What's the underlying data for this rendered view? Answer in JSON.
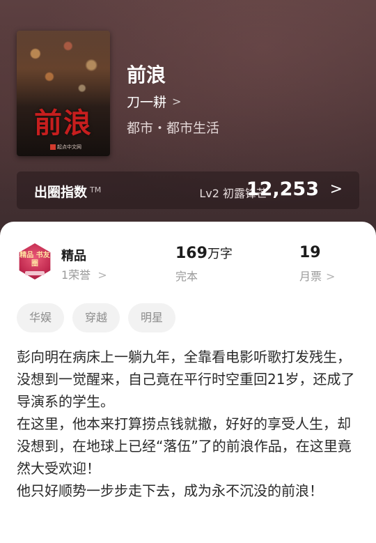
{
  "book": {
    "title": "前浪",
    "author": "刀一耕",
    "genre": "都市・都市生活",
    "cover_title": "前浪",
    "cover_publisher": "起点中文网"
  },
  "index": {
    "label": "出圈指数",
    "tm": "TM",
    "level": "Lv2 初露锋芒",
    "score": "12,253"
  },
  "stats": {
    "badge_text": "精品 书友圈",
    "honor_title": "精品",
    "honor_sub": "1荣誉",
    "words_value": "169",
    "words_unit": "万字",
    "words_status": "完本",
    "tickets_value": "19",
    "tickets_label": "月票"
  },
  "tags": [
    "华娱",
    "穿越",
    "明星"
  ],
  "description": [
    "彭向明在病床上一躺九年，全靠看电影听歌打发残生，没想到一觉醒来，自己竟在平行时空重回21岁，还成了导演系的学生。",
    "在这里，他本来打算捞点钱就撤，好好的享受人生，却没想到，在地球上已经“落伍”了的前浪作品，在这里竟然大受欢迎！",
    "他只好顺势一步步走下去，成为永不沉没的前浪！"
  ],
  "colors": {
    "hero_bg": "#4b3436",
    "badge": "#c1294f",
    "cover_title": "#c61e1e"
  },
  "icons": {
    "chevron": "chevron-right-icon"
  }
}
